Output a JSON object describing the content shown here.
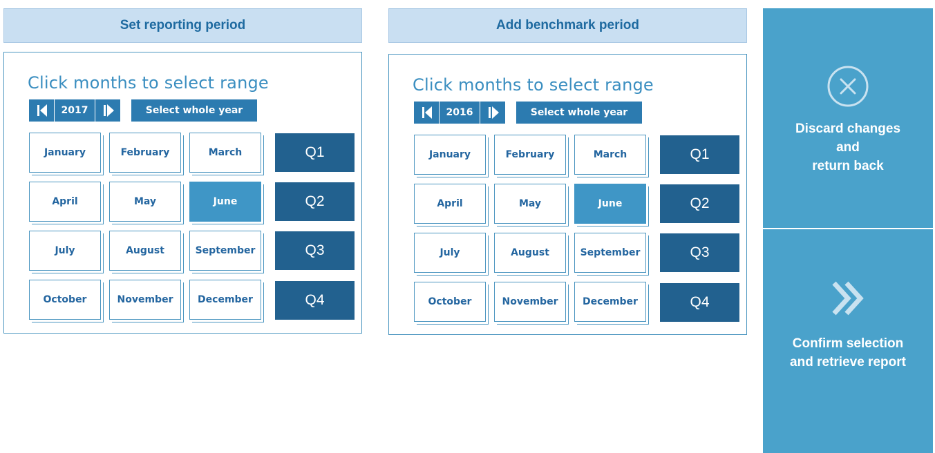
{
  "reporting": {
    "header": "Set reporting period",
    "title": "Click months to select range",
    "year": "2017",
    "whole_year_label": "Select whole year",
    "selected_months": [
      "June"
    ]
  },
  "benchmark": {
    "header": "Add benchmark period",
    "title": "Click months to select range",
    "year": "2016",
    "whole_year_label": "Select whole year",
    "selected_months": [
      "June"
    ]
  },
  "months": [
    "January",
    "February",
    "March",
    "April",
    "May",
    "June",
    "July",
    "August",
    "September",
    "October",
    "November",
    "December"
  ],
  "quarters": [
    "Q1",
    "Q2",
    "Q3",
    "Q4"
  ],
  "actions": {
    "discard": {
      "label": "Discard changes\nand\nreturn back",
      "icon": "close-circle-icon"
    },
    "confirm": {
      "label": "Confirm selection\nand retrieve report",
      "icon": "double-chevron-right-icon"
    }
  },
  "colors": {
    "header_bg": "#c9dff2",
    "accent": "#2c7bb0",
    "quarter": "#22618f",
    "selected_month": "#3f96c6",
    "side_panel": "#4aa2cb"
  }
}
